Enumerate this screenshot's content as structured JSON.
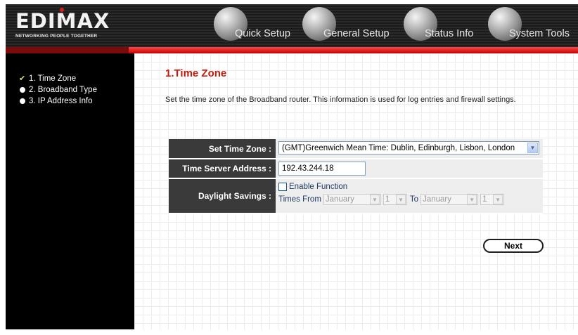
{
  "brand": {
    "logo_text": "EDIMAX",
    "tagline": "NETWORKING PEOPLE TOGETHER"
  },
  "nav": {
    "quick_setup": "Quick Setup",
    "general_setup": "General Setup",
    "status_info": "Status Info",
    "system_tools": "System Tools"
  },
  "sidebar": {
    "items": [
      {
        "label": "1. Time Zone",
        "state": "current"
      },
      {
        "label": "2. Broadband Type",
        "state": "pending"
      },
      {
        "label": "3. IP Address Info",
        "state": "pending"
      }
    ]
  },
  "page": {
    "title": "1.Time Zone",
    "description": "Set the time zone of the Broadband router. This information is used for log entries and firewall settings."
  },
  "form": {
    "time_zone_label": "Set Time Zone :",
    "time_zone_value": "(GMT)Greenwich Mean Time: Dublin, Edinburgh, Lisbon, London",
    "time_server_label": "Time Server Address :",
    "time_server_value": "192.43.244.18",
    "daylight_label": "Daylight Savings :",
    "enable_function_label": "Enable Function",
    "enable_function_checked": false,
    "times_from_label": "Times From",
    "from_month": "January",
    "from_day": "1",
    "to_label": "To",
    "to_month": "January",
    "to_day": "1"
  },
  "buttons": {
    "next": "Next"
  }
}
